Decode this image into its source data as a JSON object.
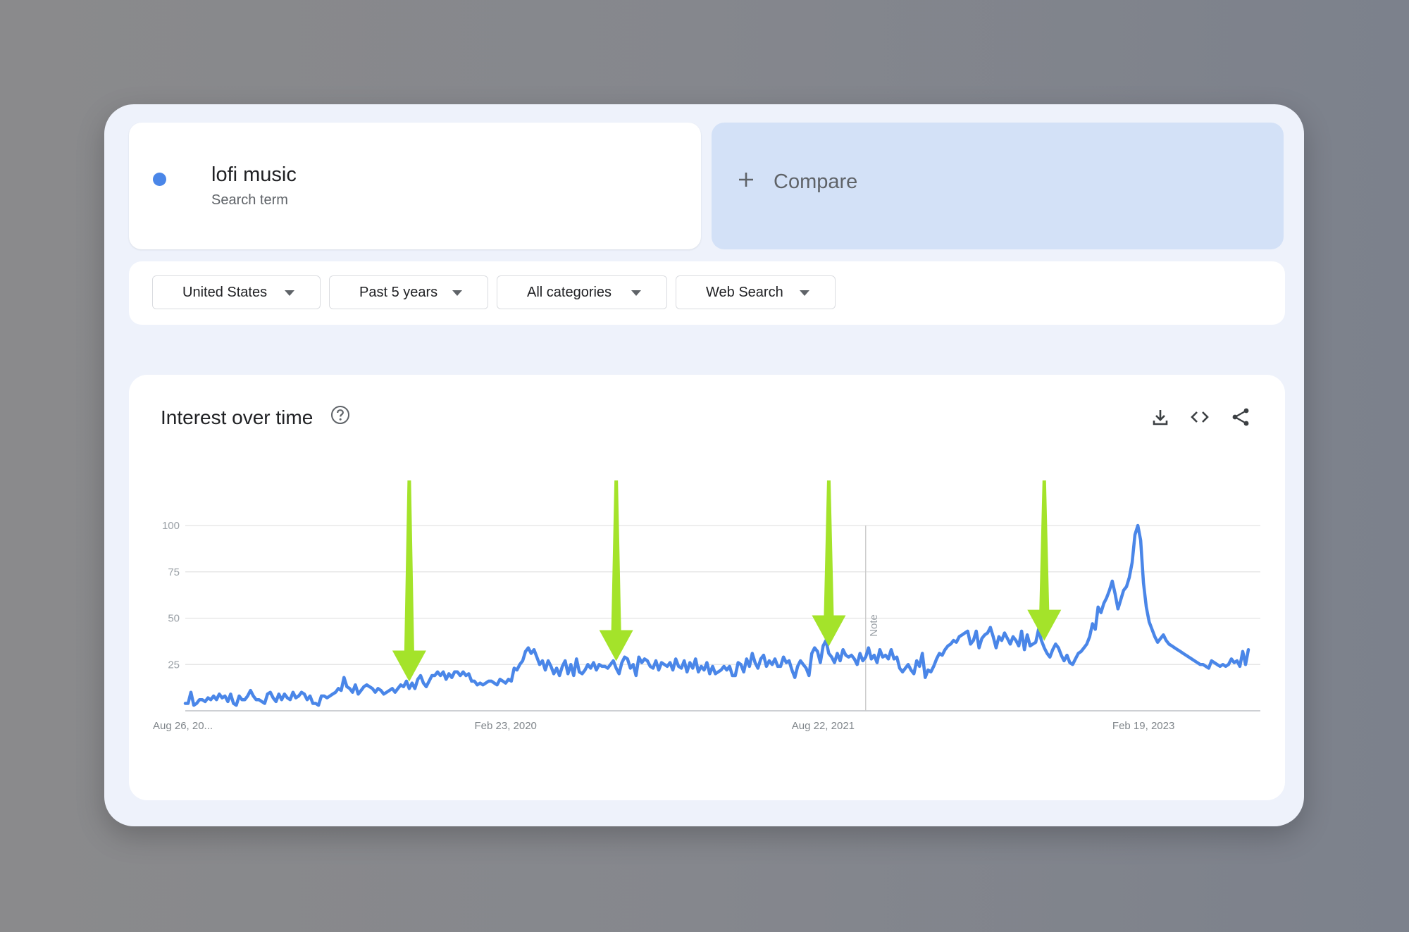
{
  "search_term": {
    "name": "lofi music",
    "subtitle": "Search term",
    "color": "#4a86e8"
  },
  "compare": {
    "label": "Compare",
    "icon": "plus-icon"
  },
  "filters": [
    {
      "label": "United States",
      "icon": "caret-down-icon"
    },
    {
      "label": "Past 5 years",
      "icon": "caret-down-icon"
    },
    {
      "label": "All categories",
      "icon": "caret-down-icon"
    },
    {
      "label": "Web Search",
      "icon": "caret-down-icon"
    }
  ],
  "interest_panel": {
    "title": "Interest over time",
    "icons": [
      "help-icon",
      "download-icon",
      "embed-code-icon",
      "share-icon"
    ]
  },
  "chart_data": {
    "type": "line",
    "title": "",
    "xlabel": "",
    "ylabel": "",
    "ylim": [
      0,
      100
    ],
    "yticks": [
      100,
      75,
      50,
      25
    ],
    "xtick_labels": [
      "Aug 26, 20...",
      "Feb 23, 2020",
      "Aug 22, 2021",
      "Feb 19, 2023"
    ],
    "x_start": "Aug 26, 2018",
    "x_end": "Aug 20, 2023",
    "annotation": "Note",
    "grid": true,
    "series": [
      {
        "color": "#4a86e8",
        "values": [
          4,
          4,
          10,
          3,
          4,
          6,
          6,
          5,
          7,
          6,
          8,
          6,
          9,
          7,
          8,
          5,
          9,
          4,
          3,
          8,
          6,
          6,
          8,
          11,
          8,
          6,
          6,
          5,
          4,
          9,
          10,
          7,
          5,
          9,
          6,
          9,
          7,
          6,
          10,
          7,
          8,
          10,
          9,
          6,
          8,
          4,
          4,
          3,
          8,
          8,
          7,
          8,
          9,
          10,
          12,
          11,
          18,
          13,
          12,
          10,
          14,
          9,
          11,
          13,
          14,
          13,
          12,
          10,
          12,
          11,
          9,
          10,
          11,
          12,
          10,
          12,
          14,
          13,
          16,
          12,
          15,
          12,
          17,
          19,
          15,
          13,
          16,
          19,
          19,
          21,
          19,
          21,
          17,
          20,
          18,
          21,
          21,
          19,
          21,
          19,
          20,
          16,
          16,
          14,
          15,
          14,
          15,
          16,
          16,
          15,
          14,
          17,
          16,
          15,
          17,
          16,
          23,
          22,
          25,
          27,
          32,
          34,
          31,
          33,
          29,
          25,
          27,
          22,
          27,
          24,
          20,
          23,
          19,
          24,
          27,
          20,
          25,
          19,
          28,
          21,
          20,
          22,
          25,
          23,
          26,
          22,
          25,
          24,
          24,
          23,
          25,
          27,
          23,
          20,
          26,
          29,
          28,
          23,
          25,
          19,
          29,
          26,
          28,
          27,
          24,
          23,
          27,
          22,
          26,
          25,
          24,
          26,
          22,
          28,
          24,
          23,
          27,
          21,
          26,
          23,
          28,
          21,
          24,
          22,
          26,
          20,
          24,
          20,
          21,
          22,
          24,
          22,
          24,
          19,
          19,
          26,
          25,
          21,
          28,
          24,
          31,
          26,
          23,
          28,
          30,
          24,
          27,
          25,
          28,
          24,
          24,
          29,
          26,
          27,
          22,
          18,
          24,
          27,
          25,
          23,
          19,
          31,
          34,
          32,
          26,
          35,
          38,
          31,
          29,
          26,
          31,
          27,
          33,
          30,
          29,
          30,
          28,
          25,
          31,
          27,
          29,
          34,
          28,
          30,
          26,
          33,
          29,
          30,
          28,
          33,
          28,
          29,
          23,
          21,
          23,
          25,
          22,
          20,
          27,
          24,
          31,
          18,
          22,
          21,
          24,
          28,
          31,
          30,
          33,
          35,
          36,
          38,
          37,
          40,
          41,
          42,
          43,
          36,
          38,
          43,
          34,
          39,
          41,
          42,
          45,
          40,
          34,
          40,
          38,
          42,
          39,
          36,
          40,
          38,
          35,
          43,
          33,
          41,
          35,
          36,
          37,
          44,
          38,
          34,
          31,
          29,
          33,
          36,
          34,
          30,
          27,
          30,
          26,
          25,
          28,
          31,
          32,
          34,
          36,
          40,
          47,
          44,
          56,
          53,
          58,
          61,
          65,
          70,
          63,
          55,
          60,
          65,
          67,
          72,
          80,
          95,
          100,
          92,
          69,
          56,
          48,
          44,
          40,
          37,
          39,
          41,
          38,
          36,
          35,
          34,
          33,
          32,
          31,
          30,
          29,
          28,
          27,
          26,
          25,
          25,
          24,
          23,
          27,
          26,
          25,
          24,
          25,
          24,
          25,
          28,
          26,
          27,
          24,
          32,
          25,
          33
        ]
      }
    ]
  }
}
